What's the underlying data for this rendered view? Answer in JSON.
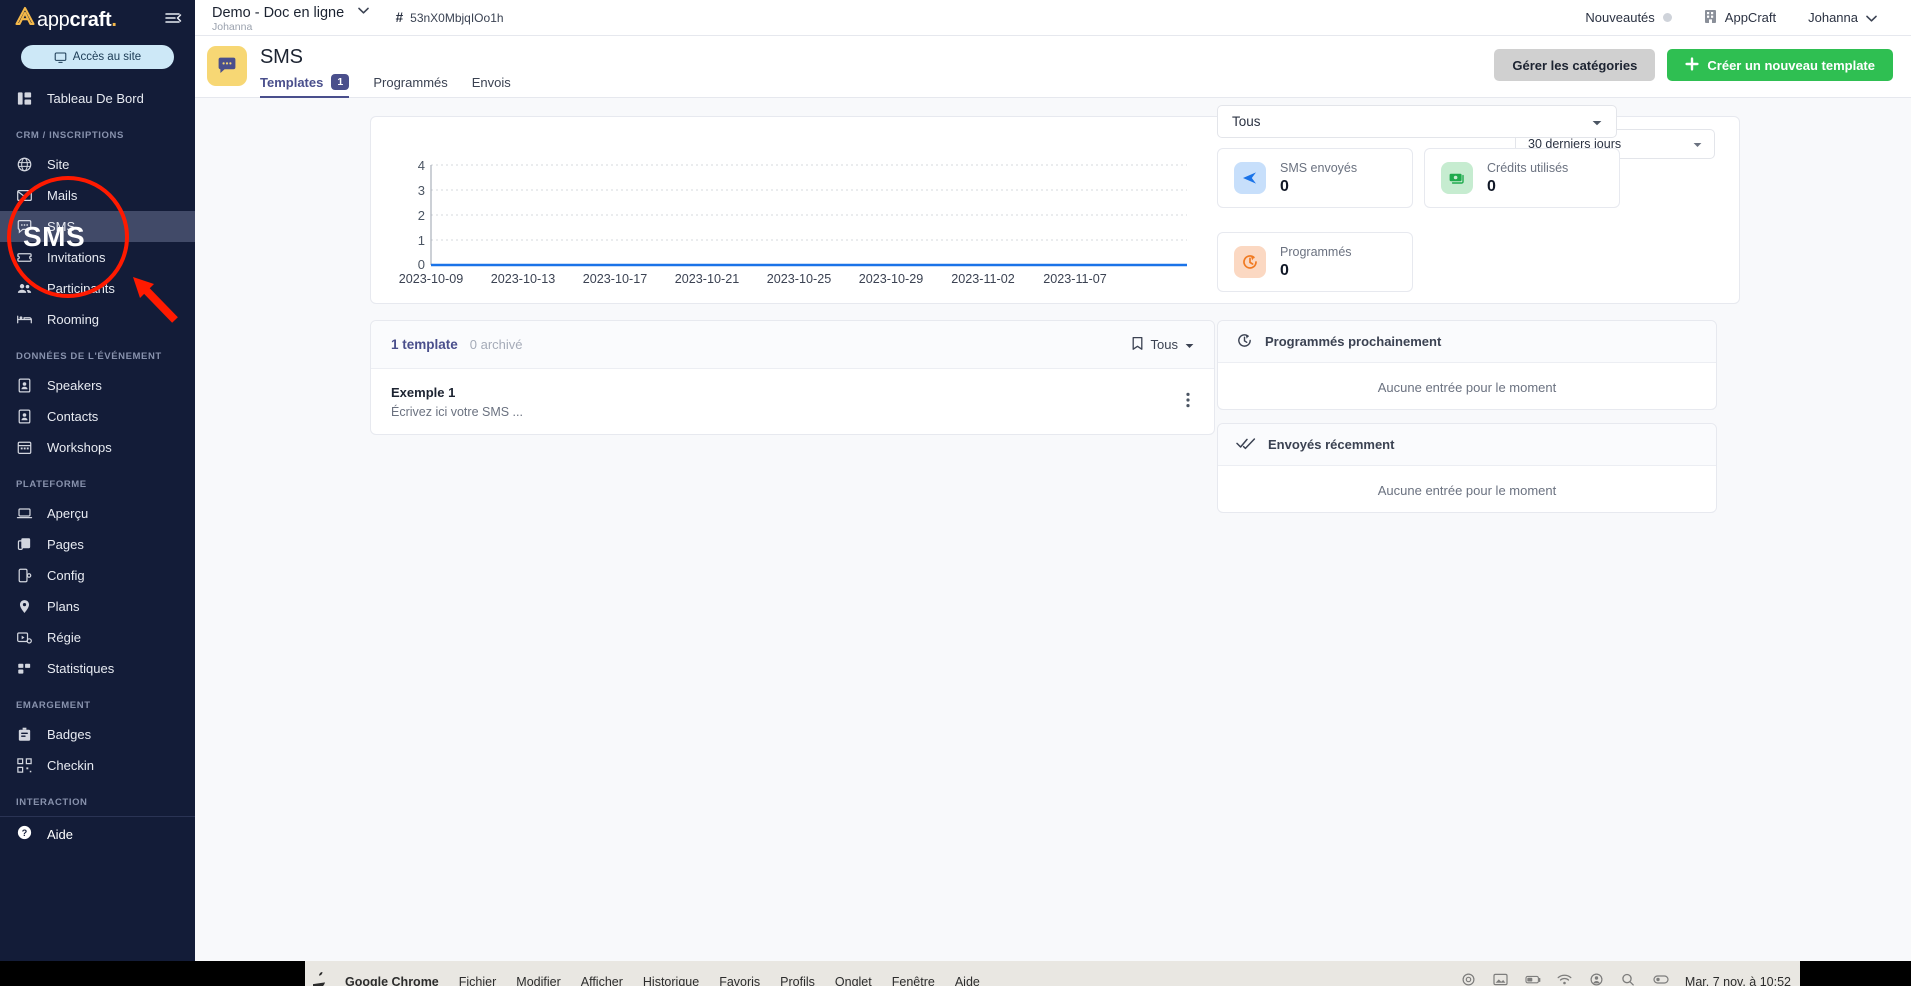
{
  "sidebar": {
    "brand": {
      "light": "app",
      "bold": "craft",
      "dot": "."
    },
    "site_button": "Accès au site",
    "dashboard": "Tableau De Bord",
    "sections": [
      {
        "title": "CRM / INSCRIPTIONS",
        "items": [
          {
            "label": "Site",
            "icon": "globe-icon",
            "active": false
          },
          {
            "label": "Mails",
            "icon": "mail-icon",
            "active": false
          },
          {
            "label": "SMS",
            "icon": "sms-icon",
            "active": true
          },
          {
            "label": "Invitations",
            "icon": "ticket-icon",
            "active": false
          },
          {
            "label": "Participants",
            "icon": "people-icon",
            "active": false
          },
          {
            "label": "Rooming",
            "icon": "bed-icon",
            "active": false
          }
        ]
      },
      {
        "title": "DONNÉES DE L'ÉVÉNEMENT",
        "items": [
          {
            "label": "Speakers",
            "icon": "badge-person-icon",
            "active": false
          },
          {
            "label": "Contacts",
            "icon": "contact-card-icon",
            "active": false
          },
          {
            "label": "Workshops",
            "icon": "calendar-icon",
            "active": false
          }
        ]
      },
      {
        "title": "PLATEFORME",
        "items": [
          {
            "label": "Aperçu",
            "icon": "laptop-icon",
            "active": false
          },
          {
            "label": "Pages",
            "icon": "copy-icon",
            "active": false
          },
          {
            "label": "Config",
            "icon": "phone-config-icon",
            "active": false
          },
          {
            "label": "Plans",
            "icon": "map-pin-icon",
            "active": false
          },
          {
            "label": "Régie",
            "icon": "video-settings-icon",
            "active": false
          },
          {
            "label": "Statistiques",
            "icon": "bar-chart-icon",
            "active": false
          }
        ]
      },
      {
        "title": "EMARGEMENT",
        "items": [
          {
            "label": "Badges",
            "icon": "badge-icon",
            "active": false
          },
          {
            "label": "Checkin",
            "icon": "qr-code-icon",
            "active": false
          }
        ]
      },
      {
        "title": "INTERACTION",
        "items": []
      }
    ],
    "help": "Aide"
  },
  "topbar": {
    "project_name": "Demo - Doc en ligne",
    "project_owner": "Johanna",
    "project_id": "53nX0MbjqIOo1h",
    "news": "Nouveautés",
    "org": "AppCraft",
    "user": "Johanna"
  },
  "page_header": {
    "title": "SMS",
    "tabs": [
      {
        "label": "Templates",
        "badge": "1",
        "active": true
      },
      {
        "label": "Programmés",
        "badge": "",
        "active": false
      },
      {
        "label": "Envois",
        "badge": "",
        "active": false
      }
    ],
    "manage_categories": "Gérer les catégories",
    "create_template": "Créer un nouveau template"
  },
  "chart_panel": {
    "range_value": "30 derniers jours"
  },
  "chart_data": {
    "type": "line",
    "title": "",
    "xlabel": "",
    "ylabel": "",
    "x": [
      "2023-10-09",
      "2023-10-13",
      "2023-10-17",
      "2023-10-21",
      "2023-10-25",
      "2023-10-29",
      "2023-11-02",
      "2023-11-07"
    ],
    "xtick_labels": [
      "2023-10-09",
      "2023-10-13",
      "2023-10-17",
      "2023-10-21",
      "2023-10-25",
      "2023-10-29",
      "2023-11-02",
      "2023-11-07"
    ],
    "ytick_labels": [
      "0",
      "1",
      "2",
      "3",
      "4"
    ],
    "ylim": [
      0,
      4
    ],
    "grid": true,
    "legend": "none",
    "series": [
      {
        "name": "SMS envoyés",
        "color": "#1a73e8",
        "values": [
          0,
          0,
          0,
          0,
          0,
          0,
          0,
          0
        ]
      }
    ]
  },
  "stats": {
    "filter_value": "Tous",
    "cards": [
      {
        "label": "SMS envoyés",
        "value": "0",
        "icon": "send-icon",
        "bg": "#c7dffb",
        "fg": "#1a73e8"
      },
      {
        "label": "Crédits utilisés",
        "value": "0",
        "icon": "money-icon",
        "bg": "#c6ecd0",
        "fg": "#1faa4d"
      },
      {
        "label": "Programmés",
        "value": "0",
        "icon": "clock-refresh-icon",
        "bg": "#fbd8c2",
        "fg": "#f07a22"
      }
    ]
  },
  "templates": {
    "count_label": "1 template",
    "archived_label": "0 archivé",
    "filter_label": "Tous",
    "rows": [
      {
        "name": "Exemple 1",
        "desc": "Écrivez ici votre SMS ..."
      }
    ]
  },
  "right_lists": [
    {
      "title": "Programmés prochainement",
      "icon": "clock-refresh-icon",
      "empty": "Aucune entrée pour le moment"
    },
    {
      "title": "Envoyés récemment",
      "icon": "double-check-icon",
      "empty": "Aucune entrée pour le moment"
    }
  ],
  "macbar": {
    "app": "Google Chrome",
    "menus": [
      "Fichier",
      "Modifier",
      "Afficher",
      "Historique",
      "Favoris",
      "Profils",
      "Onglet",
      "Fenêtre",
      "Aide"
    ],
    "clock": "Mar. 7 nov. à 10:52"
  },
  "annotation": {
    "label": "SMS",
    "color": "#ff1a00"
  },
  "colors": {
    "sidebar_bg": "#131c38",
    "accent_purple": "#4a4f8c",
    "accent_green": "#2fbf52",
    "chart_blue": "#1a73e8",
    "annotation_red": "#ff1a00"
  }
}
